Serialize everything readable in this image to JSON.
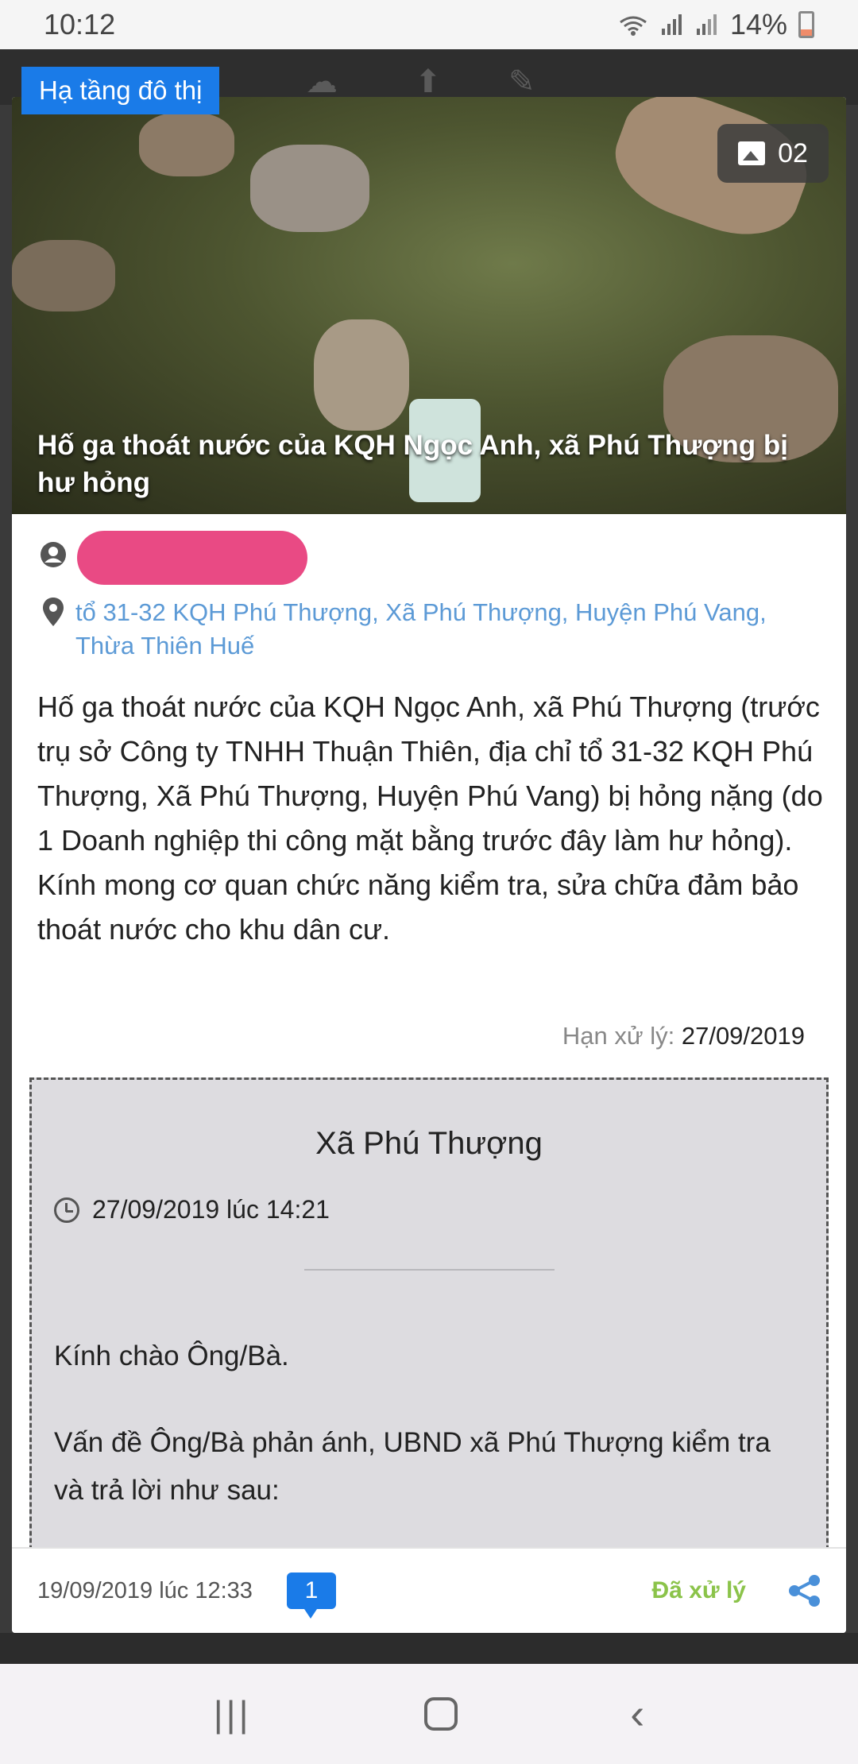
{
  "status_bar": {
    "time": "10:12",
    "battery": "14%",
    "icons": [
      "wifi-icon",
      "signal-icon",
      "signal-icon",
      "battery-icon"
    ]
  },
  "card": {
    "category": "Hạ tầng đô thị",
    "photo_count": "02",
    "photo_title": "Hố ga thoát nước của KQH Ngọc Anh, xã Phú Thượng bị hư hỏng",
    "address": "tổ 31-32 KQH Phú Thượng, Xã Phú Thượng, Huyện Phú Vang, Thừa Thiên Huế",
    "description": "Hố ga thoát nước của KQH Ngọc Anh, xã Phú Thượng (trước trụ sở Công ty TNHH Thuận Thiên, địa chỉ tổ 31-32 KQH Phú Thượng, Xã Phú Thượng, Huyện Phú Vang) bị hỏng nặng (do 1 Doanh nghiệp thi công mặt bằng trước đây làm hư hỏng). Kính mong cơ quan chức năng kiểm tra, sửa chữa đảm bảo thoát nước cho khu dân cư.",
    "deadline_label": "Hạn xử lý:",
    "deadline_value": "27/09/2019"
  },
  "response": {
    "title": "Xã Phú Thượng",
    "time": "27/09/2019 lúc 14:21",
    "greeting": "Kính chào Ông/Bà.",
    "body": "Vấn đề Ông/Bà phản ánh, UBND xã Phú Thượng kiểm tra và trả lời như sau:"
  },
  "footer": {
    "date": "19/09/2019 lúc 12:33",
    "comment_count": "1",
    "status": "Đã xử lý"
  },
  "colors": {
    "accent": "#1a7be8",
    "link": "#5c9ad6",
    "status_done": "#8bc34a",
    "redaction": "#e94a84"
  }
}
